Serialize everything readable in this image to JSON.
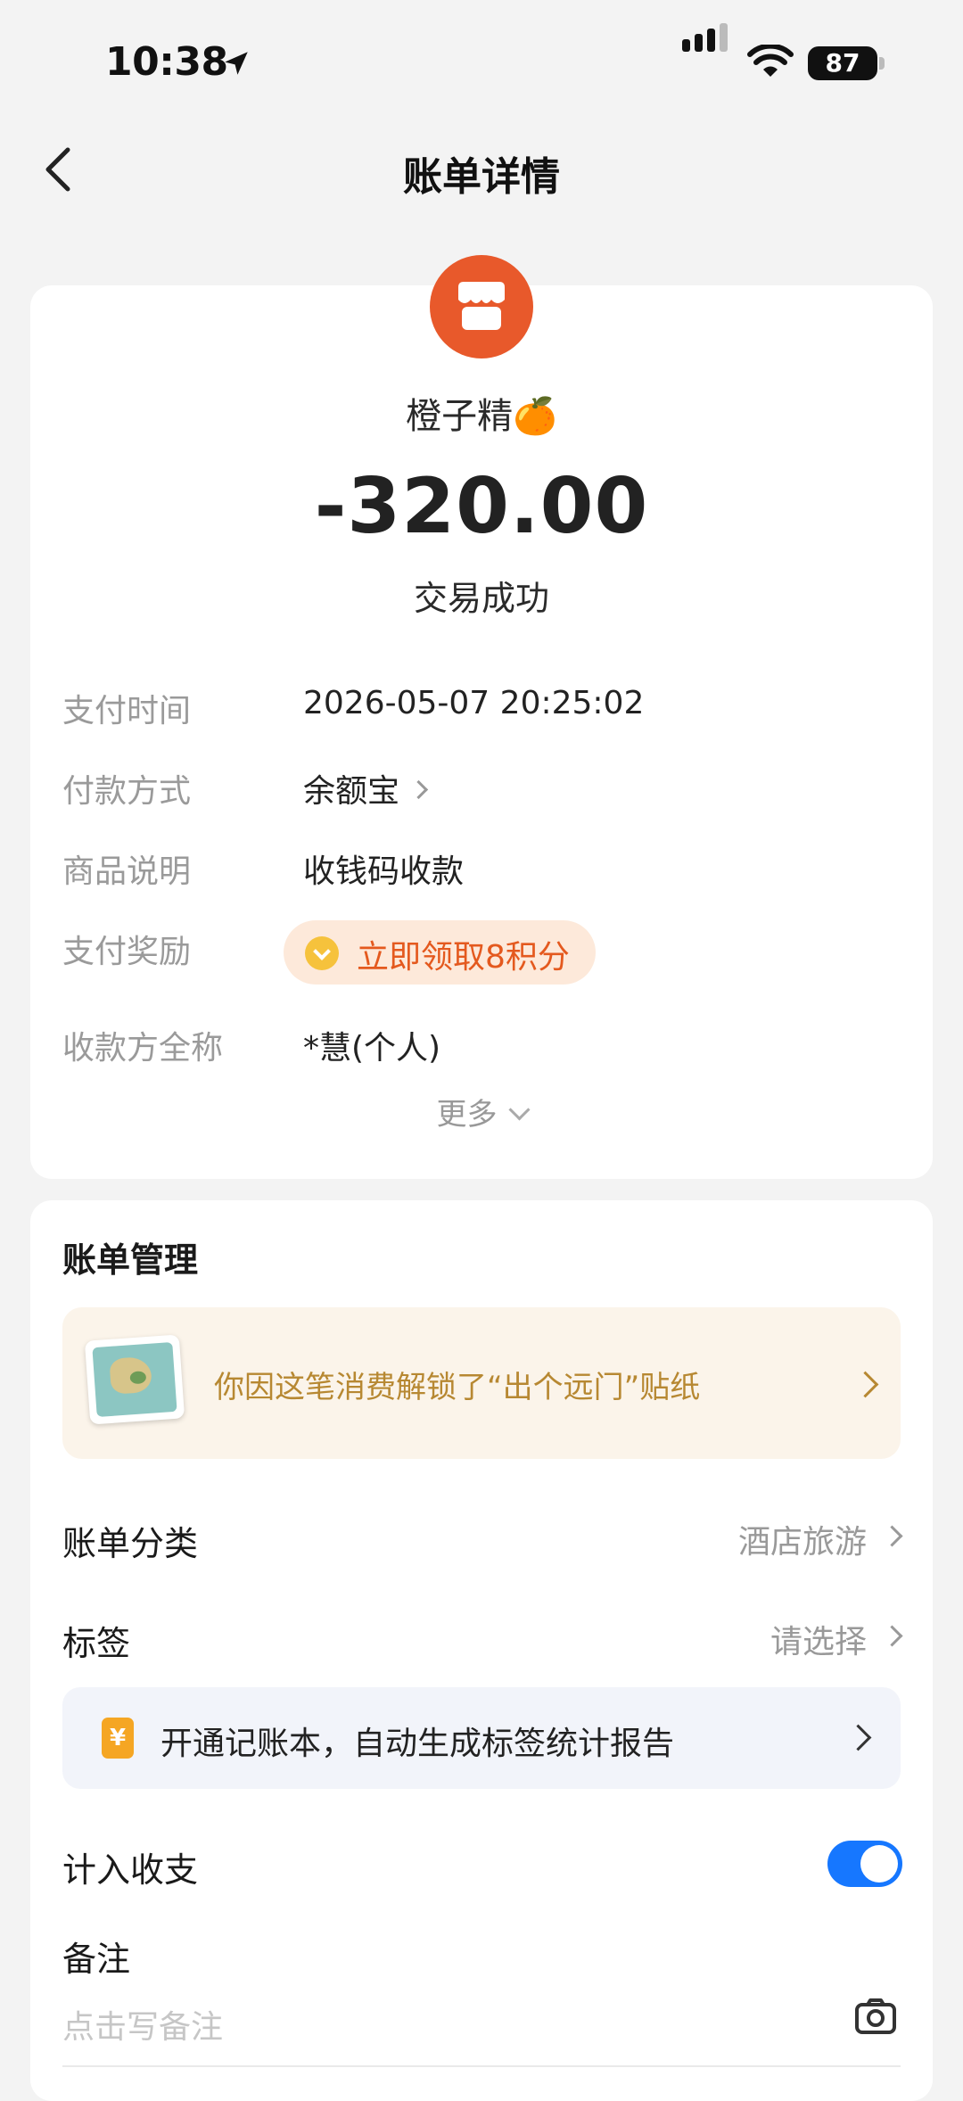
{
  "status_bar": {
    "time": "10:38",
    "battery": "87"
  },
  "nav": {
    "title": "账单详情"
  },
  "transaction": {
    "merchant": "橙子精🍊",
    "amount": "-320.00",
    "status": "交易成功"
  },
  "details": [
    {
      "label": "支付时间",
      "value": "2026-05-07 20:25:02"
    },
    {
      "label": "付款方式",
      "value": "余额宝"
    },
    {
      "label": "商品说明",
      "value": "收钱码收款"
    },
    {
      "label": "支付奖励",
      "value": "立即领取8积分"
    },
    {
      "label": "收款方全称",
      "value": "*慧(个人)"
    }
  ],
  "more_label": "更多",
  "management": {
    "title": "账单管理",
    "sticker_text": "你因这笔消费解锁了“出个远门”贴纸",
    "category_label": "账单分类",
    "category_value": "酒店旅游",
    "tag_label": "标签",
    "tag_value": "请选择",
    "ledger_icon_text": "¥",
    "ledger_text": "开通记账本，自动生成标签统计报告",
    "include_label": "计入收支",
    "include_on": true,
    "memo_label": "备注",
    "memo_placeholder": "点击写备注"
  },
  "colors": {
    "accent_orange": "#e8592b",
    "toggle_blue": "#1677ff",
    "sticker_gold": "#b78832"
  }
}
